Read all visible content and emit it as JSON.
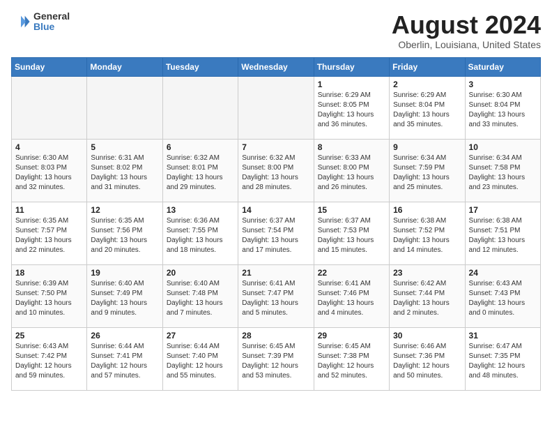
{
  "header": {
    "logo": {
      "general": "General",
      "blue": "Blue"
    },
    "title": "August 2024",
    "location": "Oberlin, Louisiana, United States"
  },
  "calendar": {
    "days_of_week": [
      "Sunday",
      "Monday",
      "Tuesday",
      "Wednesday",
      "Thursday",
      "Friday",
      "Saturday"
    ],
    "weeks": [
      [
        {
          "day": "",
          "empty": true
        },
        {
          "day": "",
          "empty": true
        },
        {
          "day": "",
          "empty": true
        },
        {
          "day": "",
          "empty": true
        },
        {
          "day": "1",
          "sunrise": "6:29 AM",
          "sunset": "8:05 PM",
          "daylight": "13 hours and 36 minutes."
        },
        {
          "day": "2",
          "sunrise": "6:29 AM",
          "sunset": "8:04 PM",
          "daylight": "13 hours and 35 minutes."
        },
        {
          "day": "3",
          "sunrise": "6:30 AM",
          "sunset": "8:04 PM",
          "daylight": "13 hours and 33 minutes."
        }
      ],
      [
        {
          "day": "4",
          "sunrise": "6:30 AM",
          "sunset": "8:03 PM",
          "daylight": "13 hours and 32 minutes."
        },
        {
          "day": "5",
          "sunrise": "6:31 AM",
          "sunset": "8:02 PM",
          "daylight": "13 hours and 31 minutes."
        },
        {
          "day": "6",
          "sunrise": "6:32 AM",
          "sunset": "8:01 PM",
          "daylight": "13 hours and 29 minutes."
        },
        {
          "day": "7",
          "sunrise": "6:32 AM",
          "sunset": "8:00 PM",
          "daylight": "13 hours and 28 minutes."
        },
        {
          "day": "8",
          "sunrise": "6:33 AM",
          "sunset": "8:00 PM",
          "daylight": "13 hours and 26 minutes."
        },
        {
          "day": "9",
          "sunrise": "6:34 AM",
          "sunset": "7:59 PM",
          "daylight": "13 hours and 25 minutes."
        },
        {
          "day": "10",
          "sunrise": "6:34 AM",
          "sunset": "7:58 PM",
          "daylight": "13 hours and 23 minutes."
        }
      ],
      [
        {
          "day": "11",
          "sunrise": "6:35 AM",
          "sunset": "7:57 PM",
          "daylight": "13 hours and 22 minutes."
        },
        {
          "day": "12",
          "sunrise": "6:35 AM",
          "sunset": "7:56 PM",
          "daylight": "13 hours and 20 minutes."
        },
        {
          "day": "13",
          "sunrise": "6:36 AM",
          "sunset": "7:55 PM",
          "daylight": "13 hours and 18 minutes."
        },
        {
          "day": "14",
          "sunrise": "6:37 AM",
          "sunset": "7:54 PM",
          "daylight": "13 hours and 17 minutes."
        },
        {
          "day": "15",
          "sunrise": "6:37 AM",
          "sunset": "7:53 PM",
          "daylight": "13 hours and 15 minutes."
        },
        {
          "day": "16",
          "sunrise": "6:38 AM",
          "sunset": "7:52 PM",
          "daylight": "13 hours and 14 minutes."
        },
        {
          "day": "17",
          "sunrise": "6:38 AM",
          "sunset": "7:51 PM",
          "daylight": "13 hours and 12 minutes."
        }
      ],
      [
        {
          "day": "18",
          "sunrise": "6:39 AM",
          "sunset": "7:50 PM",
          "daylight": "13 hours and 10 minutes."
        },
        {
          "day": "19",
          "sunrise": "6:40 AM",
          "sunset": "7:49 PM",
          "daylight": "13 hours and 9 minutes."
        },
        {
          "day": "20",
          "sunrise": "6:40 AM",
          "sunset": "7:48 PM",
          "daylight": "13 hours and 7 minutes."
        },
        {
          "day": "21",
          "sunrise": "6:41 AM",
          "sunset": "7:47 PM",
          "daylight": "13 hours and 5 minutes."
        },
        {
          "day": "22",
          "sunrise": "6:41 AM",
          "sunset": "7:46 PM",
          "daylight": "13 hours and 4 minutes."
        },
        {
          "day": "23",
          "sunrise": "6:42 AM",
          "sunset": "7:44 PM",
          "daylight": "13 hours and 2 minutes."
        },
        {
          "day": "24",
          "sunrise": "6:43 AM",
          "sunset": "7:43 PM",
          "daylight": "13 hours and 0 minutes."
        }
      ],
      [
        {
          "day": "25",
          "sunrise": "6:43 AM",
          "sunset": "7:42 PM",
          "daylight": "12 hours and 59 minutes."
        },
        {
          "day": "26",
          "sunrise": "6:44 AM",
          "sunset": "7:41 PM",
          "daylight": "12 hours and 57 minutes."
        },
        {
          "day": "27",
          "sunrise": "6:44 AM",
          "sunset": "7:40 PM",
          "daylight": "12 hours and 55 minutes."
        },
        {
          "day": "28",
          "sunrise": "6:45 AM",
          "sunset": "7:39 PM",
          "daylight": "12 hours and 53 minutes."
        },
        {
          "day": "29",
          "sunrise": "6:45 AM",
          "sunset": "7:38 PM",
          "daylight": "12 hours and 52 minutes."
        },
        {
          "day": "30",
          "sunrise": "6:46 AM",
          "sunset": "7:36 PM",
          "daylight": "12 hours and 50 minutes."
        },
        {
          "day": "31",
          "sunrise": "6:47 AM",
          "sunset": "7:35 PM",
          "daylight": "12 hours and 48 minutes."
        }
      ]
    ]
  }
}
